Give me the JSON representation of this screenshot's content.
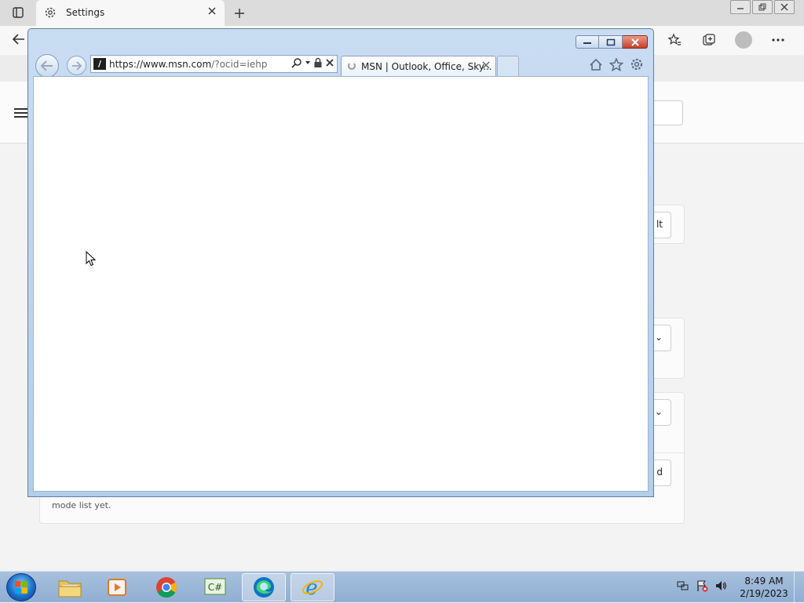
{
  "edge": {
    "tab_title": "Settings",
    "card1_button": "lt",
    "card2_dropdown": "⌄",
    "card3_dropdown": "⌄",
    "card3_button": "d",
    "card3_text": "mode list yet."
  },
  "ie": {
    "url_main": "https://www.msn.com",
    "url_rest": "/?ocid=iehp",
    "favicon": "/",
    "tab_title": "MSN | Outlook, Office, Sky...",
    "accent": "#b4cde9"
  },
  "taskbar": {
    "apps": [
      "file-explorer",
      "media-player",
      "chrome",
      "csharp-app",
      "edge",
      "internet-explorer"
    ],
    "time": "8:49 AM",
    "date": "2/19/2023"
  }
}
